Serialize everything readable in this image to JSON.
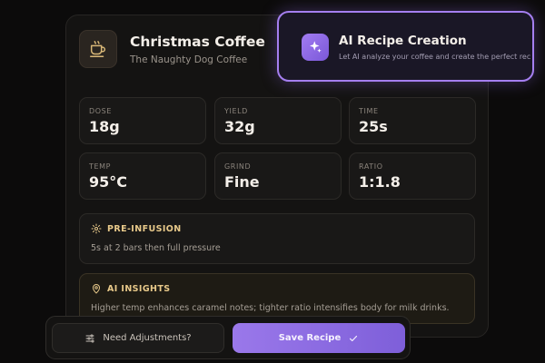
{
  "recipe": {
    "title": "Christmas Coffee",
    "subtitle": "The Naughty Dog Coffee",
    "icon": "coffee-cup-icon"
  },
  "stats": [
    {
      "label": "DOSE",
      "value": "18g"
    },
    {
      "label": "YIELD",
      "value": "32g"
    },
    {
      "label": "TIME",
      "value": "25s"
    },
    {
      "label": "TEMP",
      "value": "95°C"
    },
    {
      "label": "GRIND",
      "value": "Fine"
    },
    {
      "label": "RATIO",
      "value": "1:1.8"
    }
  ],
  "pre_infusion": {
    "title": "PRE-INFUSION",
    "text": "5s at 2 bars then full pressure",
    "icon": "gear-icon"
  },
  "ai_insights": {
    "title": "AI INSIGHTS",
    "text": "Higher temp enhances caramel notes; tighter ratio intensifies body for milk drinks.",
    "icon": "location-pin-icon"
  },
  "ai_popup": {
    "title": "AI Recipe Creation",
    "subtitle": "Let AI analyze your coffee and create the perfect rec",
    "icon": "sparkles-icon"
  },
  "actions": {
    "adjust_label": "Need Adjustments?",
    "save_label": "Save Recipe"
  },
  "colors": {
    "accent": "#9a78ea",
    "gold": "#e8c98a",
    "background": "#0c0b0b"
  }
}
